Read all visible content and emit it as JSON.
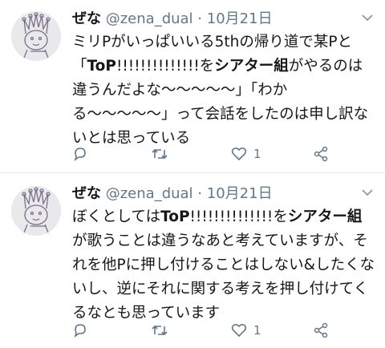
{
  "tweets": [
    {
      "name": "ぜな",
      "handle": "@zena_dual",
      "separator": "·",
      "date": "10月21日",
      "text_parts": [
        {
          "t": "ミリPがいっぱいいる5thの帰り道で某Pと「",
          "b": false
        },
        {
          "t": "ToP",
          "b": true
        },
        {
          "t": "!!!!!!!!!!!!!!を",
          "b": false
        },
        {
          "t": "シアター組",
          "b": true
        },
        {
          "t": "がやるのは違うんだよな〜〜〜〜〜」「わかる〜〜〜〜〜」って会話をしたのは申し訳ないとは思っている",
          "b": false
        }
      ],
      "like_count": "1"
    },
    {
      "name": "ぜな",
      "handle": "@zena_dual",
      "separator": "·",
      "date": "10月21日",
      "text_parts": [
        {
          "t": "ぼくとしては",
          "b": false
        },
        {
          "t": "ToP",
          "b": true
        },
        {
          "t": "!!!!!!!!!!!!!!を",
          "b": false
        },
        {
          "t": "シアター組",
          "b": true
        },
        {
          "t": "が歌うことは違うなあと考えていますが、それを他Pに押し付けることはしない&したくないし、逆にそれに関する考えを押し付けてくるなとも思っています",
          "b": false
        }
      ],
      "like_count": "1"
    }
  ],
  "icons": {
    "reply": "reply-icon",
    "retweet": "retweet-icon",
    "like": "heart-icon",
    "share": "share-icon",
    "menu": "chevron-down-icon"
  },
  "colors": {
    "icon": "#657786",
    "text": "#14171a",
    "divider": "#e6ecf0"
  }
}
